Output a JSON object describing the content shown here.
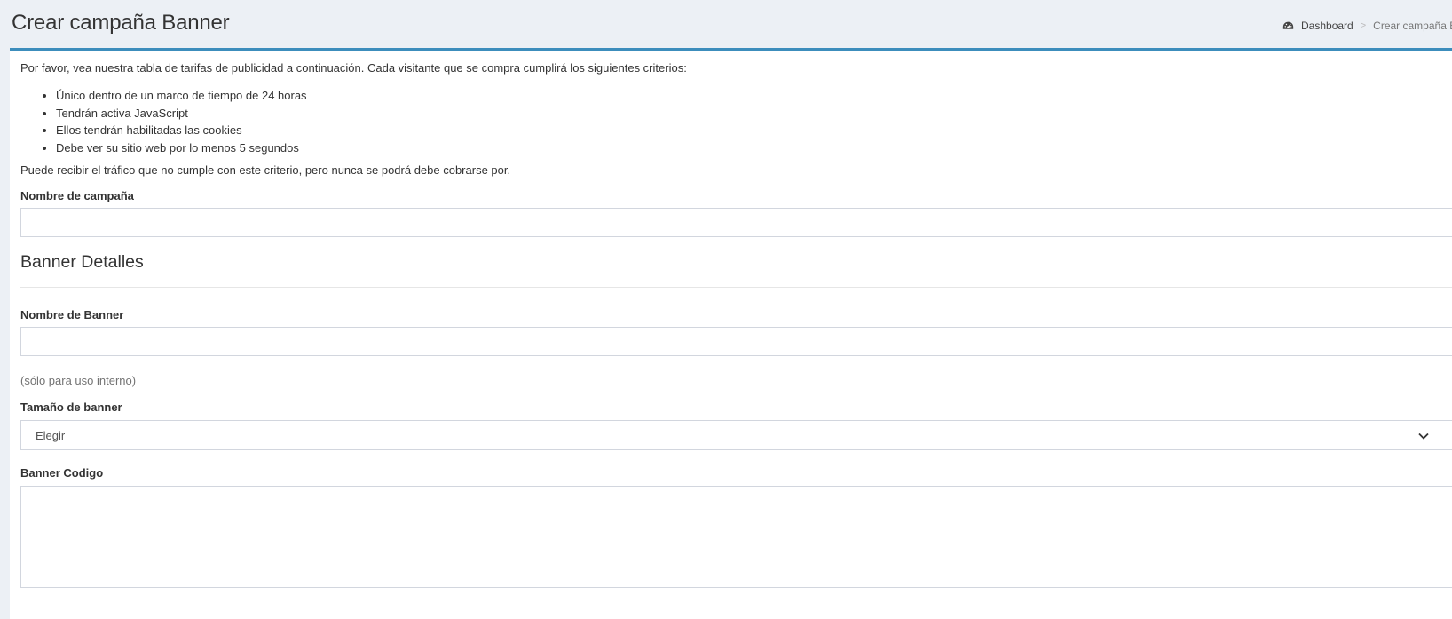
{
  "header": {
    "title": "Crear campaña Banner",
    "breadcrumb": {
      "home_icon": "dashboard-icon",
      "home_label": "Dashboard",
      "separator": ">",
      "current": "Crear campaña Banner"
    }
  },
  "accent_color": "#3c8dbc",
  "intro": "Por favor, vea nuestra tabla de tarifas de publicidad a continuación. Cada visitante que se compra cumplirá los siguientes criterios:",
  "criteria": [
    "Único dentro de un marco de tiempo de 24 horas",
    "Tendrán activa JavaScript",
    "Ellos tendrán habilitadas las cookies",
    "Debe ver su sitio web por lo menos 5 segundos"
  ],
  "note": "Puede recibir el tráfico que no cumple con este criterio, pero nunca se podrá debe cobrarse por.",
  "form": {
    "campaign_name": {
      "label": "Nombre de campaña",
      "value": ""
    },
    "section_title": "Banner Detalles",
    "banner_name": {
      "label": "Nombre de Banner",
      "value": "",
      "help": "(sólo para uso interno)"
    },
    "banner_size": {
      "label": "Tamaño de banner",
      "selected": "Elegir",
      "icon": "chevron-down-icon"
    },
    "banner_code": {
      "label": "Banner Codigo",
      "value": ""
    }
  }
}
